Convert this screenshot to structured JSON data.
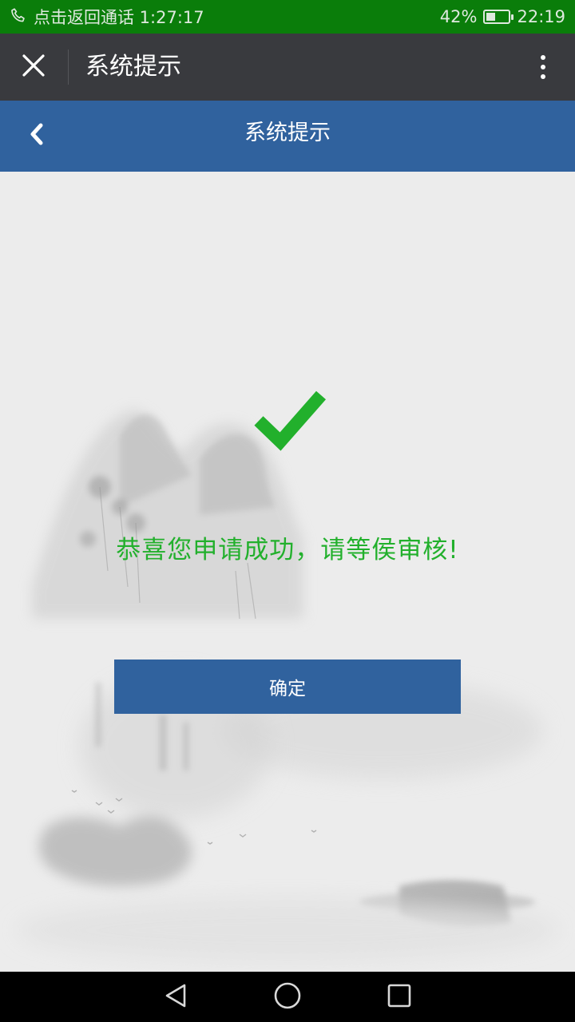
{
  "status_bar": {
    "call_text": "点击返回通话 1:27:17",
    "battery_percent": "42%",
    "battery_level": 0.42,
    "time": "22:19",
    "icons": [
      "phone-icon",
      "battery-icon"
    ]
  },
  "app_bar": {
    "title": "系统提示",
    "icons": [
      "close-icon",
      "more-icon"
    ]
  },
  "page_header": {
    "title": "系统提示",
    "icons": [
      "back-chevron-icon"
    ]
  },
  "main": {
    "message": "恭喜您申请成功，请等侯审核!",
    "confirm_label": "确定",
    "icons": [
      "checkmark-icon"
    ]
  },
  "nav_bar": {
    "icons": [
      "back-triangle-icon",
      "home-circle-icon",
      "recents-square-icon"
    ]
  },
  "colors": {
    "status_bar": "#0a7d0a",
    "app_bar": "#393a3e",
    "header": "#30629e",
    "success": "#22b02c",
    "button": "#30629e",
    "background": "#ececec"
  }
}
